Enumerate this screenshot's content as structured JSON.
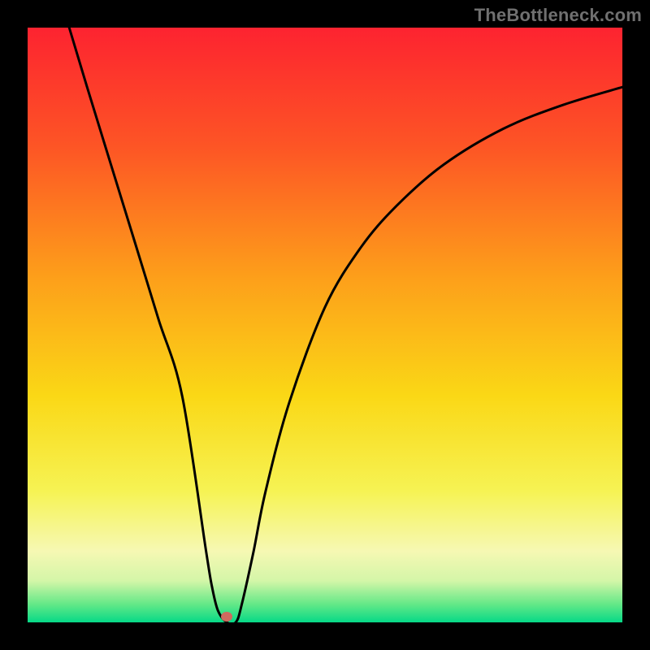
{
  "attribution": "TheBottleneck.com",
  "gradient": {
    "stops": [
      {
        "pct": 0,
        "color": "#fd2330"
      },
      {
        "pct": 20,
        "color": "#fd5525"
      },
      {
        "pct": 42,
        "color": "#fd9f1a"
      },
      {
        "pct": 62,
        "color": "#fad816"
      },
      {
        "pct": 78,
        "color": "#f6f354"
      },
      {
        "pct": 88,
        "color": "#f6f8b3"
      },
      {
        "pct": 93,
        "color": "#d4f6a8"
      },
      {
        "pct": 97,
        "color": "#62e887"
      },
      {
        "pct": 100,
        "color": "#06d987"
      }
    ]
  },
  "marker": {
    "x_pct": 33.5,
    "y_pct": 99.0,
    "color": "#cf6a5f"
  },
  "chart_data": {
    "type": "line",
    "title": "",
    "xlabel": "",
    "ylabel": "",
    "xlim": [
      0,
      100
    ],
    "ylim": [
      0,
      100
    ],
    "grid": false,
    "series": [
      {
        "name": "curve",
        "x": [
          7,
          10,
          14,
          18,
          22,
          26,
          30,
          31,
          32,
          33.5,
          35,
          36,
          38,
          40,
          44,
          50,
          56,
          62,
          70,
          80,
          90,
          100
        ],
        "y": [
          100,
          90,
          77,
          64,
          51,
          38,
          12,
          6,
          2,
          0,
          0,
          3,
          12,
          22,
          37,
          53,
          63,
          70,
          77,
          83,
          87,
          90
        ]
      }
    ],
    "annotations": [
      {
        "type": "point",
        "x": 33.5,
        "y": 0
      }
    ]
  }
}
